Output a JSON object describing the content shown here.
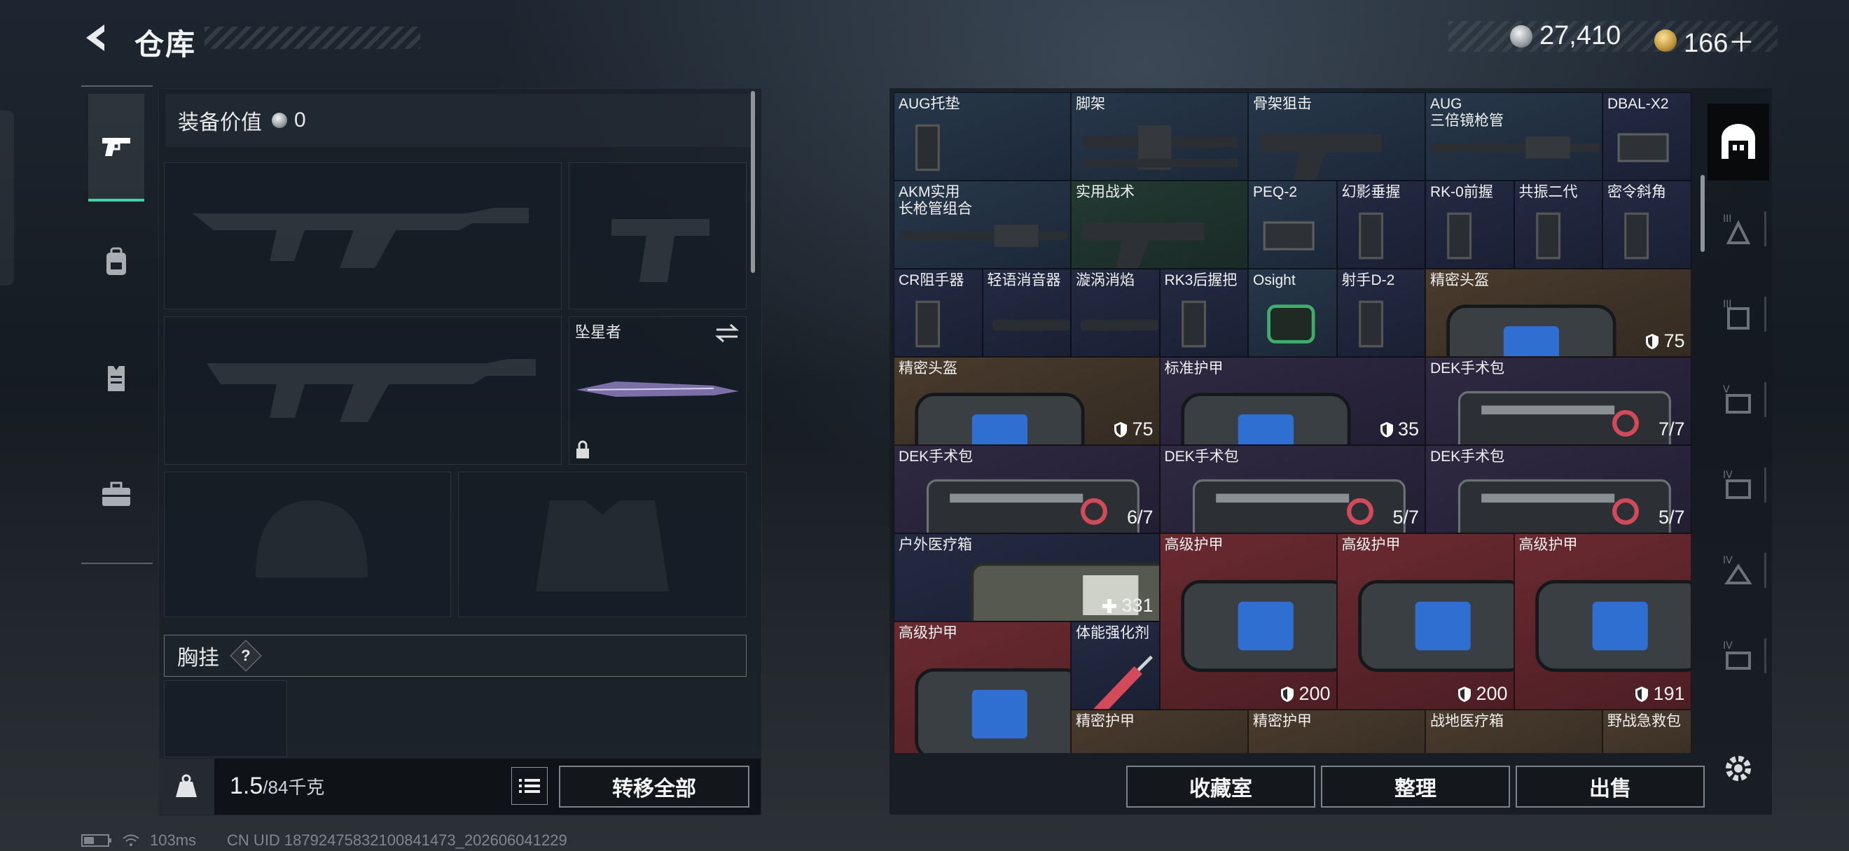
{
  "header": {
    "title": "仓库",
    "currency": [
      {
        "icon": "silver-coin-icon",
        "value": "27,410"
      },
      {
        "icon": "gold-coin-icon",
        "value": "166＋"
      }
    ]
  },
  "left_tabs": [
    {
      "icon": "pistol-icon",
      "active": true
    },
    {
      "icon": "backpack-icon",
      "active": false
    },
    {
      "icon": "vest-icon",
      "active": false
    },
    {
      "icon": "medkit-icon",
      "active": false
    }
  ],
  "equipment": {
    "value_label": "装备价值",
    "value": "0",
    "melee_name": "坠星者",
    "chest_label": "胸挂",
    "chest_help": "?"
  },
  "bottom_left": {
    "weight": "1.5",
    "weight_max": "/84千克",
    "transfer_all": "转移全部"
  },
  "stash_items": [
    {
      "name": "AUG托垫",
      "count": ""
    },
    {
      "name": "脚架",
      "count": ""
    },
    {
      "name": "骨架狙击",
      "count": ""
    },
    {
      "name": "AUG\n三倍镜枪管",
      "count": ""
    },
    {
      "name": "DBAL-X2",
      "count": ""
    },
    {
      "name": "AKM实用\n长枪管组合",
      "count": ""
    },
    {
      "name": "实用战术",
      "count": ""
    },
    {
      "name": "PEQ-2",
      "count": ""
    },
    {
      "name": "幻影垂握",
      "count": ""
    },
    {
      "name": "RK-0前握",
      "count": ""
    },
    {
      "name": "共振二代",
      "count": ""
    },
    {
      "name": "密令斜角",
      "count": ""
    },
    {
      "name": "CR阻手器",
      "count": ""
    },
    {
      "name": "轻语消音器",
      "count": ""
    },
    {
      "name": "漩涡消焰",
      "count": ""
    },
    {
      "name": "RK3后握把",
      "count": ""
    },
    {
      "name": "Osight",
      "count": ""
    },
    {
      "name": "射手D-2",
      "count": ""
    },
    {
      "name": "精密头盔",
      "count": "75"
    },
    {
      "name": "精密头盔",
      "count": "75"
    },
    {
      "name": "标准护甲",
      "count": "35"
    },
    {
      "name": "DEK手术包",
      "count": "7/7"
    },
    {
      "name": "DEK手术包",
      "count": "6/7"
    },
    {
      "name": "DEK手术包",
      "count": "5/7"
    },
    {
      "name": "DEK手术包",
      "count": "5/7"
    },
    {
      "name": "户外医疗箱",
      "count": "331"
    },
    {
      "name": "高级护甲",
      "count": "200"
    },
    {
      "name": "高级护甲",
      "count": "200"
    },
    {
      "name": "高级护甲",
      "count": "191"
    },
    {
      "name": "高级护甲",
      "count": ""
    },
    {
      "name": "体能强化剂",
      "count": ""
    },
    {
      "name": "精密护甲",
      "count": ""
    },
    {
      "name": "精密护甲",
      "count": ""
    },
    {
      "name": "战地医疗箱",
      "count": ""
    },
    {
      "name": "野战急救包",
      "count": ""
    }
  ],
  "stash_buttons": {
    "collection": "收藏室",
    "sort": "整理",
    "sell": "出售"
  },
  "right_tabs": [
    {
      "icon": "stash-arch-icon",
      "active": true
    },
    {
      "icon": "case-tier-iii-icon"
    },
    {
      "icon": "case-tier-iii-icon"
    },
    {
      "icon": "case-tier-v-icon"
    },
    {
      "icon": "case-tier-iv-icon"
    },
    {
      "icon": "case-tier-iv-icon"
    },
    {
      "icon": "case-tier-iv-icon"
    }
  ],
  "status": {
    "ping": "103ms",
    "uid": "CN UID 18792475832100841473_202606041229"
  }
}
